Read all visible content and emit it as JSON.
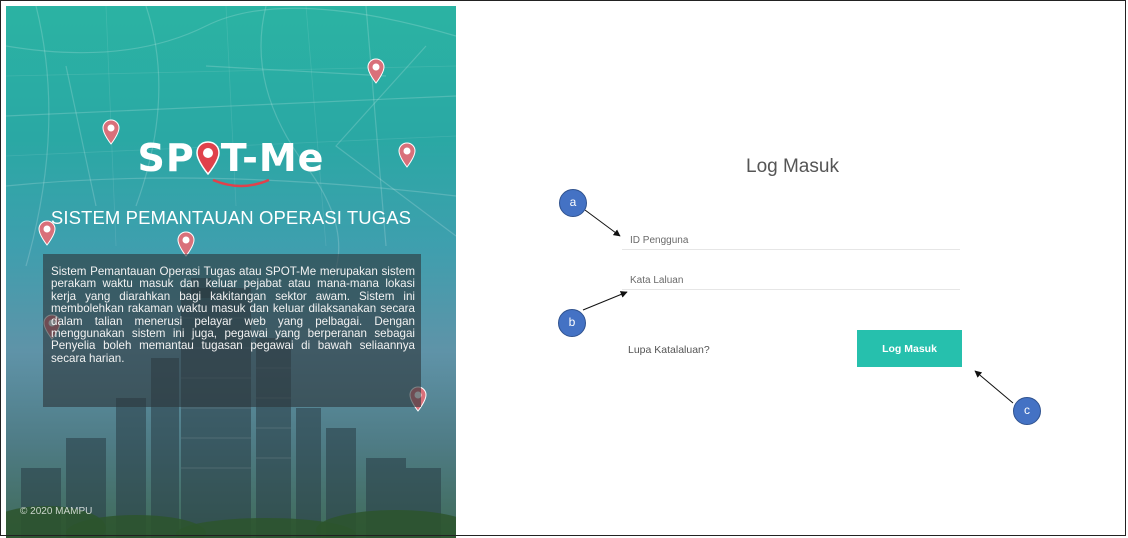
{
  "hero": {
    "logo_left": "SP",
    "logo_right": "T-Me",
    "title": "SISTEM PEMANTAUAN OPERASI TUGAS",
    "description": "Sistem Pemantauan Operasi Tugas atau SPOT-Me merupakan sistem perakam waktu masuk dan keluar pejabat atau mana-mana lokasi kerja yang diarahkan bagi kakitangan sektor awam. Sistem ini membolehkan rakaman waktu masuk dan keluar dilaksanakan secara dalam talian menerusi pelayar web yang pelbagai. Dengan menggunakan sistem ini juga, pegawai yang berperanan sebagai Penyelia boleh memantau tugasan pegawai di bawah seliaannya secara harian.",
    "copyright": "© 2020 MAMPU"
  },
  "login": {
    "title": "Log Masuk",
    "username_placeholder": "ID Pengguna",
    "password_placeholder": "Kata Laluan",
    "forgot_label": "Lupa Katalaluan?",
    "submit_label": "Log Masuk"
  },
  "annotations": {
    "a": "a",
    "b": "b",
    "c": "c"
  },
  "colors": {
    "accent": "#26c0ad",
    "pin": "#e0525a",
    "badge": "#4472c4"
  },
  "icons": [
    "map-pin-icon"
  ]
}
